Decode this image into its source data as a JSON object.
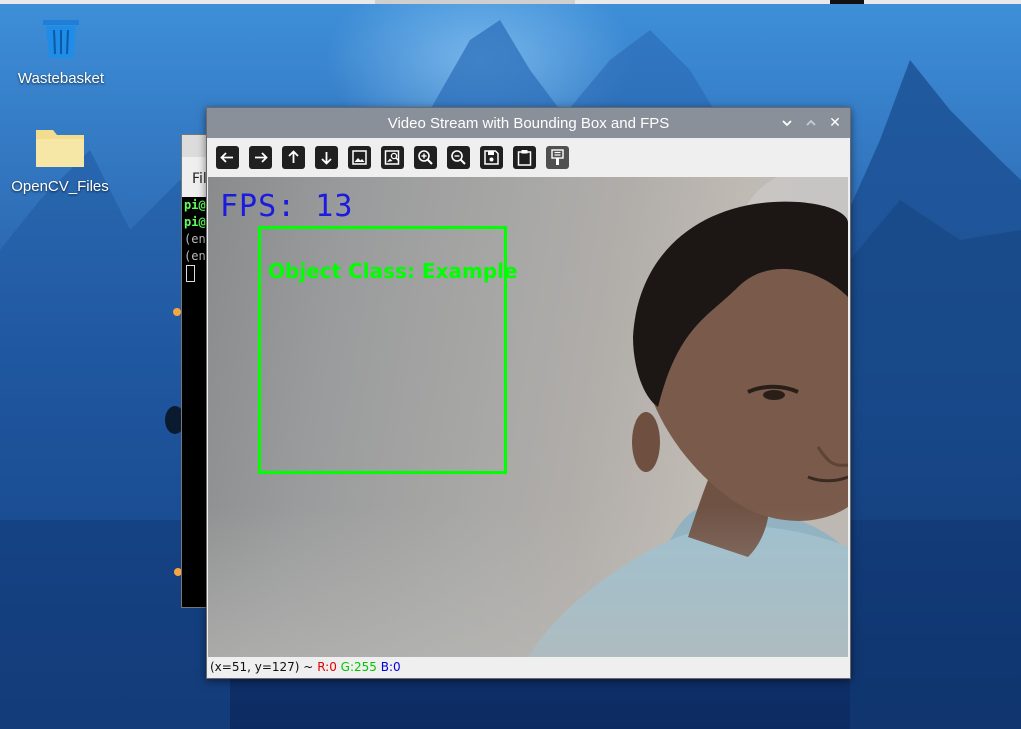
{
  "desktop": {
    "icons": [
      {
        "label": "Wastebasket",
        "icon": "trash-icon"
      },
      {
        "label": "OpenCV_Files",
        "icon": "folder-icon"
      }
    ]
  },
  "terminal": {
    "menu_text": "Fil",
    "lines": [
      {
        "text": "pi@",
        "style": "prompt"
      },
      {
        "text": "pi@",
        "style": "prompt"
      },
      {
        "text": "(en",
        "style": "output"
      },
      {
        "text": "(en",
        "style": "output"
      }
    ]
  },
  "window": {
    "title": "Video Stream with Bounding Box and FPS",
    "controls": [
      "chevron-down-icon",
      "chevron-up-icon",
      "close-icon"
    ],
    "close_glyph": "✕",
    "toolbar": [
      "arrow-left-icon",
      "arrow-right-icon",
      "arrow-up-icon",
      "arrow-down-icon",
      "image-icon",
      "image-search-icon",
      "zoom-in-icon",
      "zoom-out-icon",
      "save-icon",
      "clipboard-icon",
      "paint-brush-icon"
    ],
    "video": {
      "fps_text": "FPS: 13",
      "bbox_label": "Object Class: Example",
      "bbox_color": "#00ff00",
      "fps_color": "#1a1ae0"
    },
    "status": {
      "coords": "(x=51, y=127) ~",
      "r": "R:0",
      "g": "G:255",
      "b": "B:0"
    }
  }
}
